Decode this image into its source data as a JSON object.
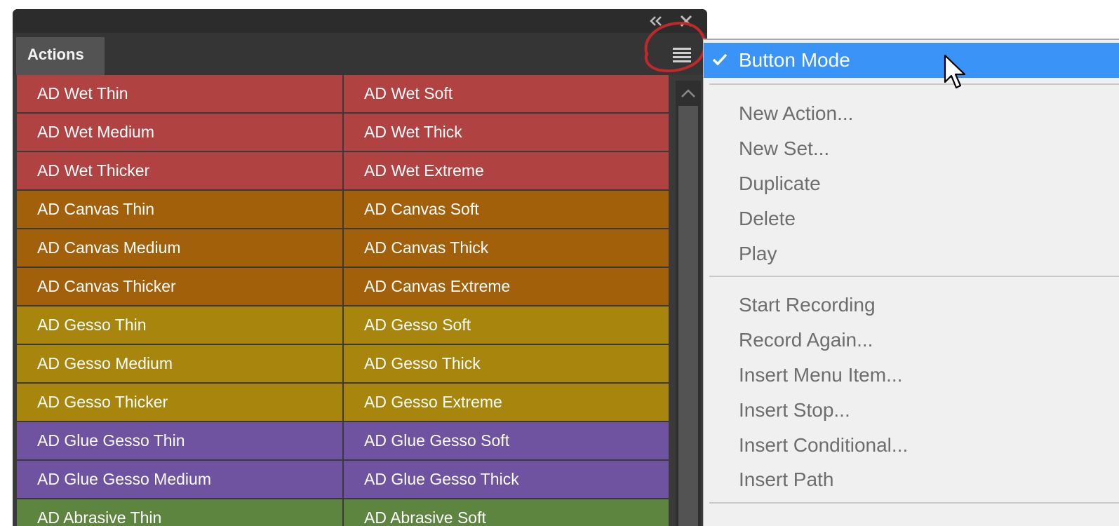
{
  "panel": {
    "tab_label": "Actions",
    "icons": {
      "collapse": "double-chevron-icon",
      "close": "close-icon",
      "menu": "hamburger-menu-icon",
      "scroll_up": "chevron-up-icon"
    },
    "colors": {
      "red": "#b04342",
      "orange": "#a2600b",
      "yellow": "#a8860d",
      "purple": "#6f53a0",
      "green": "#5d8540",
      "highlight_circle": "#c0282a"
    },
    "actions": [
      [
        "AD Wet Thin",
        "AD Wet Soft"
      ],
      [
        "AD Wet Medium",
        "AD Wet Thick"
      ],
      [
        "AD Wet Thicker",
        "AD Wet Extreme"
      ],
      [
        "AD Canvas Thin",
        "AD Canvas Soft"
      ],
      [
        "AD Canvas Medium",
        "AD Canvas Thick"
      ],
      [
        "AD Canvas Thicker",
        "AD Canvas Extreme"
      ],
      [
        "AD Gesso Thin",
        "AD Gesso Soft"
      ],
      [
        "AD Gesso Medium",
        "AD Gesso Thick"
      ],
      [
        "AD Gesso Thicker",
        "AD Gesso Extreme"
      ],
      [
        "AD Glue Gesso Thin",
        "AD Glue Gesso Soft"
      ],
      [
        "AD Glue Gesso Medium",
        "AD Glue Gesso Thick"
      ],
      [
        "AD Abrasive Thin",
        "AD Abrasive Soft"
      ]
    ]
  },
  "flyout": {
    "selected_color": "#3a93f7",
    "items": [
      "Button Mode",
      "New Action...",
      "New Set...",
      "Duplicate",
      "Delete",
      "Play",
      "Start Recording",
      "Record Again...",
      "Insert Menu Item...",
      "Insert Stop...",
      "Insert Conditional...",
      "Insert Path"
    ],
    "checked_item": "Button Mode",
    "check_icon": "checkmark-icon",
    "cursor_icon": "mouse-pointer-icon"
  }
}
